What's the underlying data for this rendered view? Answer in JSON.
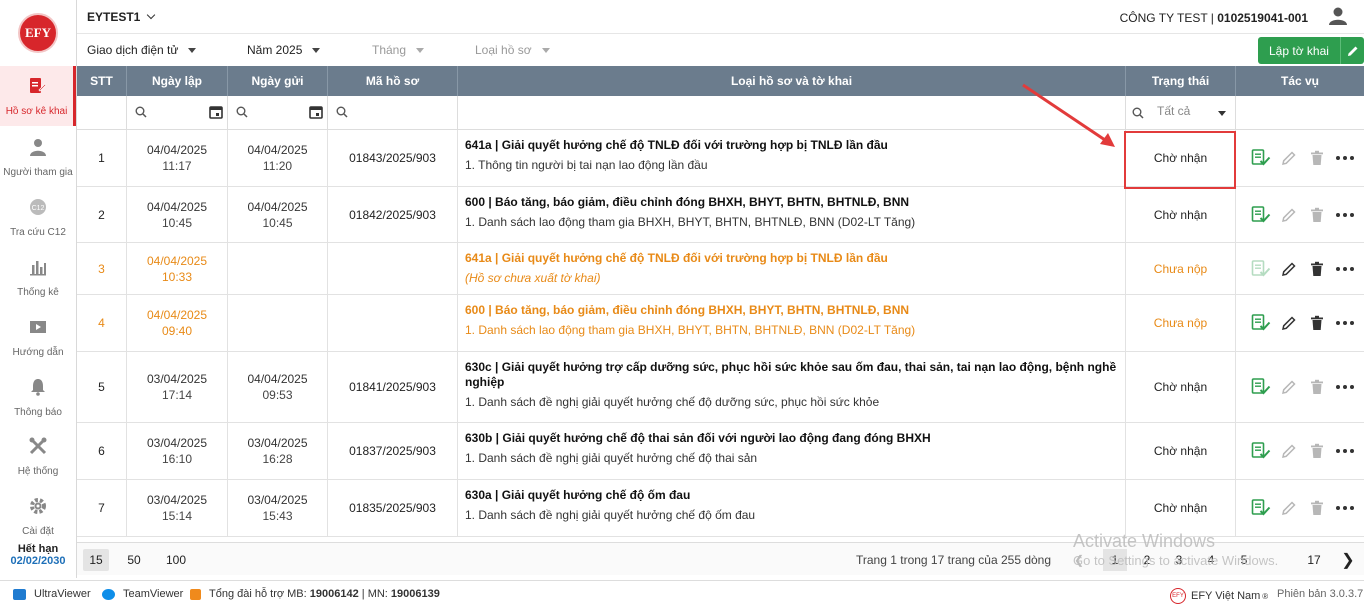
{
  "sidebar": {
    "logo": "EFY",
    "items": [
      {
        "label": "Hồ sơ kê khai",
        "icon": "document-edit-icon"
      },
      {
        "label": "Người tham gia",
        "icon": "person-icon"
      },
      {
        "label": "Tra cứu C12",
        "icon": "search-c12-icon"
      },
      {
        "label": "Thống kê",
        "icon": "bar-chart-icon"
      },
      {
        "label": "Hướng dẫn",
        "icon": "video-guide-icon"
      },
      {
        "label": "Thông báo",
        "icon": "bell-icon"
      },
      {
        "label": "Hệ thống",
        "icon": "tools-icon"
      },
      {
        "label": "Cài đặt",
        "icon": "gear-icon"
      }
    ],
    "expiry_label": "Hết hạn",
    "expiry_date": "02/02/2030"
  },
  "header": {
    "tenant": "EYTEST1",
    "company_name": "CÔNG TY TEST | ",
    "company_code": "0102519041-001"
  },
  "filters": {
    "transaction": "Giao dịch điện tử",
    "year": "Năm 2025",
    "month": "Tháng",
    "doc_type": "Loại hồ sơ",
    "create_button": "Lập tờ khai"
  },
  "table": {
    "columns": [
      "STT",
      "Ngày lập",
      "Ngày gửi",
      "Mã hồ sơ",
      "Loại hồ sơ và tờ khai",
      "Trạng thái",
      "Tác vụ"
    ],
    "status_filter": "Tất cả",
    "rows": [
      {
        "stt": "1",
        "created_date": "04/04/2025",
        "created_time": "11:17",
        "sent_date": "04/04/2025",
        "sent_time": "11:20",
        "code": "01843/2025/903",
        "title": "641a | Giải quyết hưởng chế độ TNLĐ đối với trường hợp bị TNLĐ lần đầu",
        "sub": "1. Thông tin người bị tai nạn lao động lần đầu",
        "status": "Chờ nhận",
        "draft": false
      },
      {
        "stt": "2",
        "created_date": "04/04/2025",
        "created_time": "10:45",
        "sent_date": "04/04/2025",
        "sent_time": "10:45",
        "code": "01842/2025/903",
        "title": "600 | Báo tăng, báo giảm, điều chỉnh đóng BHXH, BHYT, BHTN, BHTNLĐ, BNN",
        "sub": "1. Danh sách lao động tham gia BHXH, BHYT, BHTN, BHTNLĐ, BNN (D02-LT Tăng)",
        "status": "Chờ nhận",
        "draft": false
      },
      {
        "stt": "3",
        "created_date": "04/04/2025",
        "created_time": "10:33",
        "sent_date": "",
        "sent_time": "",
        "code": "",
        "title": "641a | Giải quyết hưởng chế độ TNLĐ đối với trường hợp bị TNLĐ lần đầu",
        "sub": "(Hồ sơ chưa xuất tờ khai)",
        "status": "Chưa nộp",
        "draft": true
      },
      {
        "stt": "4",
        "created_date": "04/04/2025",
        "created_time": "09:40",
        "sent_date": "",
        "sent_time": "",
        "code": "",
        "title": "600 | Báo tăng, báo giảm, điều chỉnh đóng BHXH, BHYT, BHTN, BHTNLĐ, BNN",
        "sub": "1. Danh sách lao động tham gia BHXH, BHYT, BHTN, BHTNLĐ, BNN (D02-LT Tăng)",
        "status": "Chưa nộp",
        "draft": true
      },
      {
        "stt": "5",
        "created_date": "03/04/2025",
        "created_time": "17:14",
        "sent_date": "04/04/2025",
        "sent_time": "09:53",
        "code": "01841/2025/903",
        "title": "630c | Giải quyết hưởng trợ cấp dưỡng sức, phục hồi sức khỏe sau ốm đau, thai sản, tai nạn lao động, bệnh nghề nghiệp",
        "sub": "1. Danh sách đề nghị giải quyết hưởng chế độ dưỡng sức, phục hồi sức khỏe",
        "status": "Chờ nhận",
        "draft": false
      },
      {
        "stt": "6",
        "created_date": "03/04/2025",
        "created_time": "16:10",
        "sent_date": "03/04/2025",
        "sent_time": "16:28",
        "code": "01837/2025/903",
        "title": "630b | Giải quyết hưởng chế độ thai sản đối với người lao động đang đóng BHXH",
        "sub": "1. Danh sách đề nghị giải quyết hưởng chế độ thai sản",
        "status": "Chờ nhận",
        "draft": false
      },
      {
        "stt": "7",
        "created_date": "03/04/2025",
        "created_time": "15:14",
        "sent_date": "03/04/2025",
        "sent_time": "15:43",
        "code": "01835/2025/903",
        "title": "630a | Giải quyết hưởng chế độ ốm đau",
        "sub": "1. Danh sách đề nghị giải quyết hưởng chế độ ốm đau",
        "status": "Chờ nhận",
        "draft": false
      }
    ]
  },
  "pager": {
    "sizes": [
      "15",
      "50",
      "100"
    ],
    "info": "Trang 1 trong 17 trang của 255 dòng",
    "pages": [
      "1",
      "2",
      "3",
      "4",
      "5",
      "17"
    ]
  },
  "watermark": {
    "line1": "Activate Windows",
    "line2": "Go to Settings to activate Windows."
  },
  "statusbar": {
    "ultraviewer": "UltraViewer",
    "teamviewer": "TeamViewer",
    "hotline_label": "Tổng đài hỗ trợ MB: ",
    "hotline_mb": "19006142",
    "hotline_sep": " | MN: ",
    "hotline_mn": "19006139",
    "brand": "EFY Việt Nam",
    "version": "Phiên bản 3.0.3.7"
  },
  "colors": {
    "accent": "#d7262b",
    "header": "#6b7c8d",
    "green": "#2e9e4f",
    "draft": "#e88a17",
    "arrow": "#e23b3b"
  }
}
